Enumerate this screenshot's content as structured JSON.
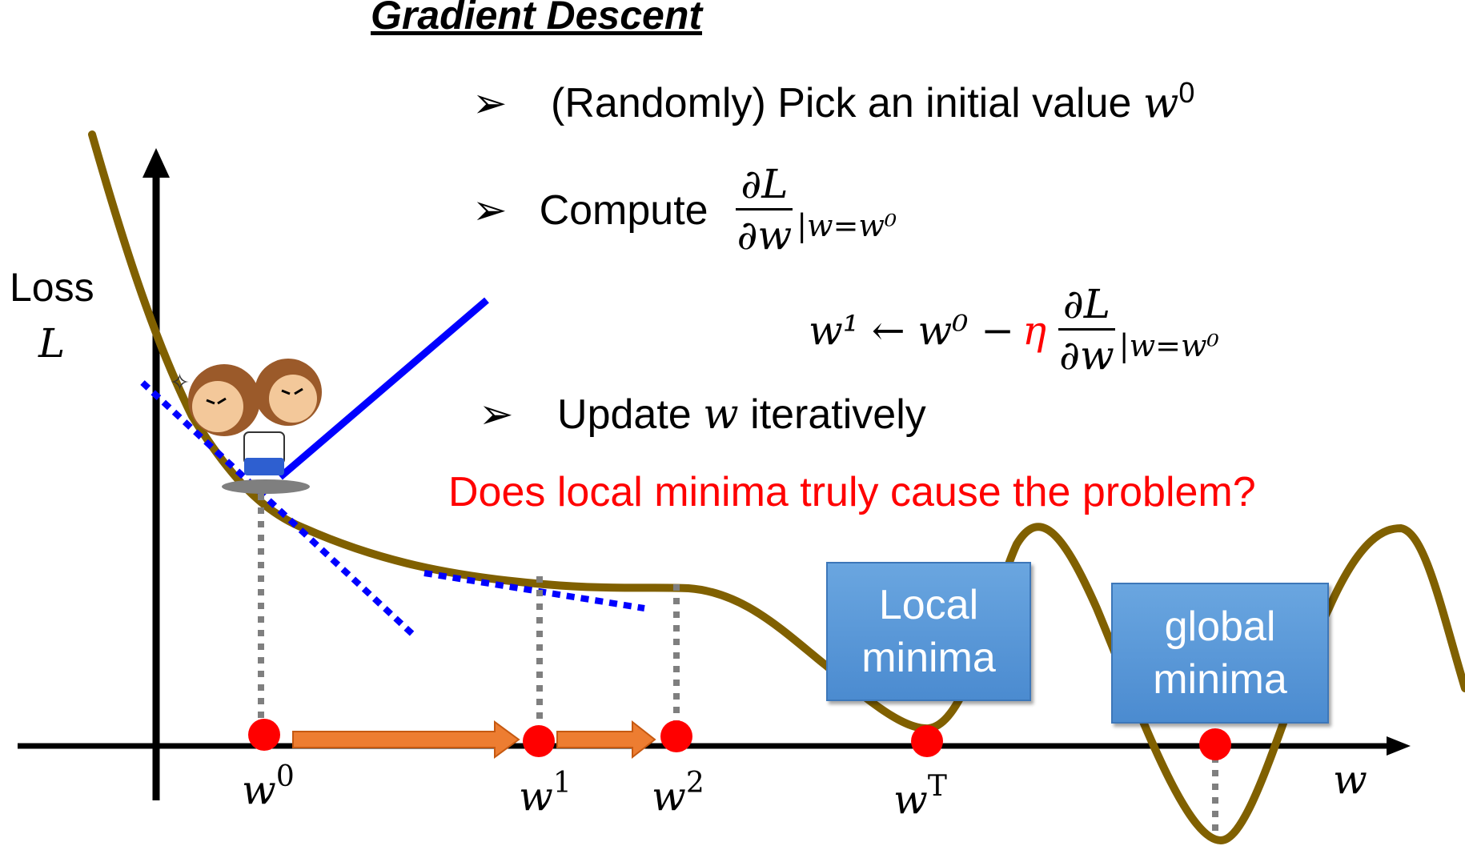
{
  "title": "Gradient Descent",
  "steps": [
    {
      "bullet": "➢",
      "text": "(Randomly) Pick an initial value",
      "var": "w",
      "sup": "0"
    },
    {
      "bullet": "➢",
      "text": "Compute",
      "frac_num": "∂L",
      "frac_den": "∂w",
      "eval": "|w=w⁰"
    },
    {
      "bullet": "➢",
      "text_pre": "Update",
      "var": "w",
      "text_post": "iteratively"
    }
  ],
  "update_rule": {
    "lhs": "w¹ ← w⁰ −",
    "eta": "η",
    "frac_num": "∂L",
    "frac_den": "∂w",
    "eval": "|w=w⁰"
  },
  "question": "Does local minima truly cause the problem?",
  "axis": {
    "y_label_line1": "Loss",
    "y_label_line2": "L",
    "x_label": "w"
  },
  "points": [
    {
      "base": "w",
      "sup": "0"
    },
    {
      "base": "w",
      "sup": "1"
    },
    {
      "base": "w",
      "sup": "2"
    },
    {
      "base": "w",
      "sup": "T"
    }
  ],
  "boxes": {
    "local": {
      "line1": "Local",
      "line2": "minima"
    },
    "global": {
      "line1": "global",
      "line2": "minima"
    }
  },
  "colors": {
    "curve": "#806000",
    "tangent": "#0000ff",
    "point": "#ff0000",
    "step_arrow": "#ed7d31",
    "dotted": "#7f7f7f",
    "box": "#5b9bd5",
    "question": "#ff0000"
  }
}
